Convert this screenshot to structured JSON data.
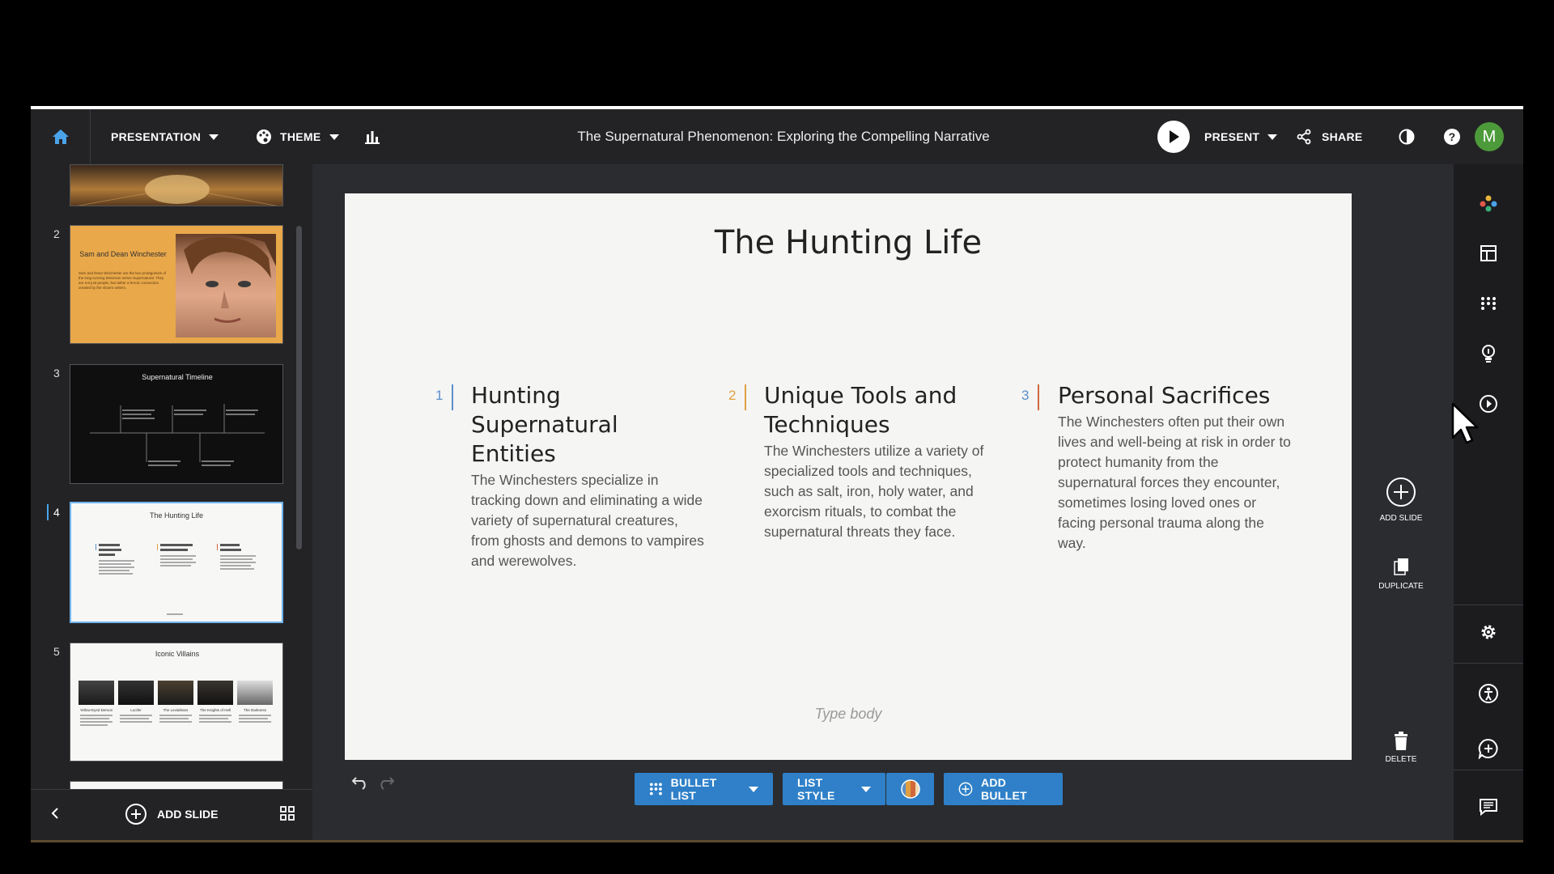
{
  "topbar": {
    "presentation_label": "PRESENTATION",
    "theme_label": "THEME",
    "doc_title": "The Supernatural Phenomenon: Exploring the Compelling Narrative",
    "present_label": "PRESENT",
    "share_label": "SHARE",
    "avatar_initial": "M"
  },
  "thumbnails": [
    {
      "num": "2",
      "title": "Sam and Dean Winchester",
      "text": "Sam and Dean Winchester are the two protagonists of the long-running television series Supernatural. They are not just people, but rather a heroic connection created by the show's writers."
    },
    {
      "num": "3",
      "title": "Supernatural Timeline"
    },
    {
      "num": "4",
      "title": "The Hunting Life"
    },
    {
      "num": "5",
      "title": "Iconic Villains",
      "villains": [
        "Yellow-Eyed Demon",
        "Lucifer",
        "The Leviathans",
        "The Knights of Hell",
        "The Darkness"
      ]
    }
  ],
  "left_footer": {
    "add_slide_label": "ADD SLIDE"
  },
  "slide": {
    "title": "The Hunting Life",
    "columns": [
      {
        "num": "1",
        "heading": "Hunting Supernatural Entities",
        "body": "The Winchesters specialize in tracking down and eliminating a wide variety of supernatural creatures, from ghosts and demons to vampires and werewolves.",
        "color": "#5b8fc9"
      },
      {
        "num": "2",
        "heading": "Unique Tools and Techniques",
        "body": "The Winchesters utilize a variety of specialized tools and techniques, such as salt, iron, holy water, and exorcism rituals, to combat the supernatural threats they face.",
        "color": "#e0a040"
      },
      {
        "num": "3",
        "heading": "Personal Sacrifices",
        "body": "The Winchesters often put their own lives and well-being at risk in order to protect humanity from the supernatural forces they encounter, sometimes losing loved ones or facing personal trauma along the way.",
        "color": "#d0683a"
      }
    ],
    "placeholder": "Type body"
  },
  "side_tools": {
    "add_slide": "ADD SLIDE",
    "duplicate": "DUPLICATE",
    "delete": "DELETE"
  },
  "bottom_toolbar": {
    "bullet_list": "BULLET LIST",
    "list_style": "LIST STYLE",
    "add_bullet": "ADD BULLET"
  },
  "right_icons": [
    "colors-icon",
    "layout-icon",
    "bullets-icon",
    "lightbulb-icon",
    "play-circle-icon",
    "settings-icon",
    "accessibility-icon",
    "comment-add-icon",
    "notes-icon"
  ]
}
